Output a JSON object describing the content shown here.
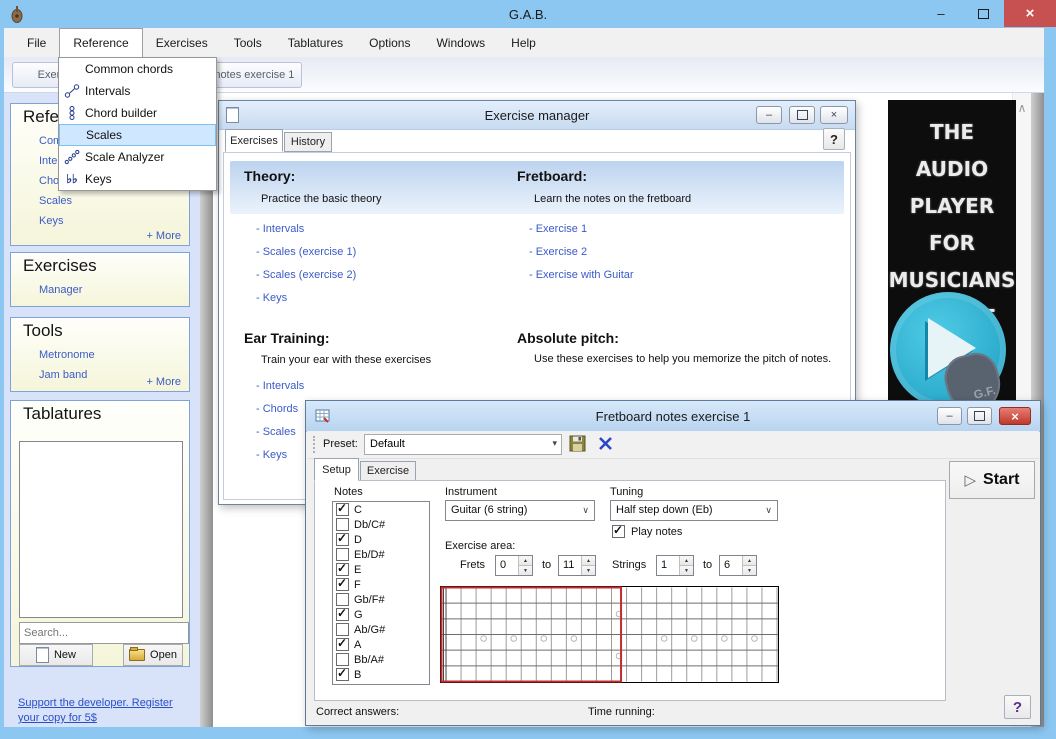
{
  "window": {
    "title": "G.A.B."
  },
  "menu": {
    "items": [
      "File",
      "Reference",
      "Exercises",
      "Tools",
      "Tablatures",
      "Options",
      "Windows",
      "Help"
    ],
    "open_index": 1
  },
  "reference_menu": {
    "items": [
      {
        "label": "Common chords",
        "icon": null,
        "selected": false
      },
      {
        "label": "Intervals",
        "icon": "intervals",
        "selected": false
      },
      {
        "label": "Chord builder",
        "icon": "chord-builder",
        "selected": false
      },
      {
        "label": "Scales",
        "icon": null,
        "selected": true
      },
      {
        "label": "Scale Analyzer",
        "icon": "scale-analyzer",
        "selected": false
      },
      {
        "label": "Keys",
        "icon": "keys",
        "selected": false
      }
    ]
  },
  "window_tabs": {
    "tab1": "Exercise manager",
    "tab2": "Fretboard notes exercise 1"
  },
  "sidebar": {
    "reference": {
      "title": "Reference",
      "links": [
        "Common chords",
        "Intervals",
        "Chord builder",
        "Scales",
        "Keys"
      ],
      "more": "+ More"
    },
    "exercises": {
      "title": "Exercises",
      "links": [
        "Manager"
      ]
    },
    "tools": {
      "title": "Tools",
      "links": [
        "Metronome",
        "Jam band"
      ],
      "more": "+ More"
    },
    "tablatures": {
      "title": "Tablatures",
      "search_placeholder": "Search...",
      "new_label": "New",
      "open_label": "Open"
    },
    "support_link": "Support the developer. Register your copy for 5$"
  },
  "exercise_manager": {
    "title": "Exercise manager",
    "tabs": [
      "Exercises",
      "History"
    ],
    "help_label": "?",
    "theory": {
      "heading": "Theory:",
      "subtitle": "Practice the basic theory",
      "links": [
        "- Intervals",
        "- Scales (exercise 1)",
        "- Scales (exercise 2)",
        "- Keys"
      ]
    },
    "fretboard": {
      "heading": "Fretboard:",
      "subtitle": "Learn the notes on the fretboard",
      "links": [
        "- Exercise 1",
        "- Exercise 2",
        "- Exercise with Guitar"
      ]
    },
    "ear_training": {
      "heading": "Ear Training:",
      "subtitle": "Train your ear with these exercises",
      "links": [
        "- Intervals",
        "- Chords",
        "- Scales",
        "- Keys"
      ]
    },
    "absolute_pitch": {
      "heading": "Absolute pitch:",
      "subtitle": "Use these exercises to help you memorize the pitch of notes."
    }
  },
  "fretboard_window": {
    "title": "Fretboard notes exercise 1",
    "toolbar": {
      "preset_label": "Preset:",
      "preset_value": "Default"
    },
    "tabs": [
      "Setup",
      "Exercise"
    ],
    "start_label": "Start",
    "notes_label": "Notes",
    "notes": [
      {
        "label": "C",
        "checked": true
      },
      {
        "label": "Db/C#",
        "checked": false
      },
      {
        "label": "D",
        "checked": true
      },
      {
        "label": "Eb/D#",
        "checked": false
      },
      {
        "label": "E",
        "checked": true
      },
      {
        "label": "F",
        "checked": true
      },
      {
        "label": "Gb/F#",
        "checked": false
      },
      {
        "label": "G",
        "checked": true
      },
      {
        "label": "Ab/G#",
        "checked": false
      },
      {
        "label": "A",
        "checked": true
      },
      {
        "label": "Bb/A#",
        "checked": false
      },
      {
        "label": "B",
        "checked": true
      }
    ],
    "instrument_label": "Instrument",
    "instrument_value": "Guitar (6 string)",
    "tuning_label": "Tuning",
    "tuning_value": "Half step down (Eb)",
    "play_notes_label": "Play notes",
    "play_notes_checked": true,
    "exercise_area_label": "Exercise area:",
    "frets_label": "Frets",
    "to_label": "to",
    "frets_from": "0",
    "frets_to": "11",
    "strings_label": "Strings",
    "strings_from": "1",
    "strings_to": "6",
    "fretboard": {
      "frets": 22,
      "strings": 6,
      "single_dots": [
        3,
        5,
        7,
        9,
        15,
        17,
        19,
        21
      ],
      "double_dots": [
        12
      ],
      "highlight_from": 0,
      "highlight_to": 11
    },
    "status": {
      "correct_label": "Correct answers:",
      "time_label": "Time running:"
    },
    "help_label": "?"
  },
  "ad": {
    "lines": [
      "THE",
      "AUDIO",
      "PLAYER",
      "FOR",
      "MUSICIANS",
      "IS HERE"
    ],
    "badge": "G.F."
  },
  "colors": {
    "titlebar_blue": "#8cc7f2",
    "close_red": "#c75050",
    "link_blue": "#3a5bc7",
    "menu_highlight": "#cfe8ff",
    "exercise_area_red": "#c42b2b",
    "ad_cyan": "#2fb3d4"
  }
}
